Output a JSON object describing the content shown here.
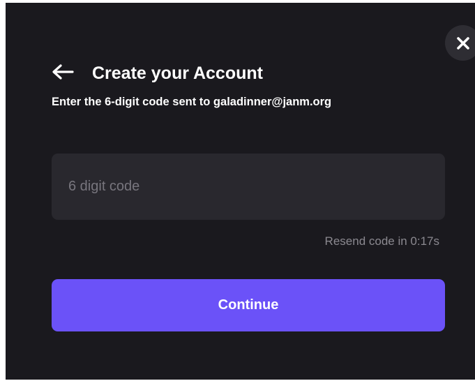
{
  "modal": {
    "title": "Create your Account",
    "subtitle": "Enter the 6-digit code sent to galadinner@janm.org",
    "close_icon": "close-icon",
    "back_icon": "arrow-left-icon"
  },
  "form": {
    "code_placeholder": "6 digit code",
    "code_value": "",
    "resend_text": "Resend code in 0:17s",
    "continue_label": "Continue"
  },
  "colors": {
    "background": "#1a191e",
    "input_background": "#29282e",
    "accent": "#6b52f8",
    "muted_text": "#8b8990"
  }
}
